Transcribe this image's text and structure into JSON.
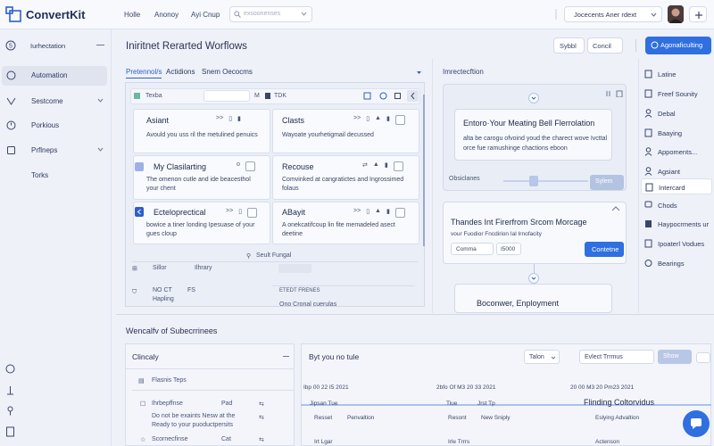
{
  "app": {
    "brand": "ConvertKit"
  },
  "topnav": {
    "items": [
      "Holle",
      "Anonoy",
      "Ayi Cnup"
    ]
  },
  "search": {
    "placeholder": "exsoonenses"
  },
  "account": {
    "name": "Jocecents Aner rdext"
  },
  "sidebar": {
    "section": "Iurhectation",
    "items": [
      {
        "label": "Automation",
        "icon": "lightning-icon",
        "active": true
      },
      {
        "label": "Sestcome",
        "icon": "funnel-icon"
      },
      {
        "label": "Porkious",
        "icon": "clock-icon"
      },
      {
        "label": "Prflneps",
        "icon": "tag-icon"
      },
      {
        "label": "Torks",
        "icon": ""
      }
    ]
  },
  "page": {
    "title": "Iniritnet Rerarted Worflows",
    "sort_label": "Sybbl",
    "cancel_label": "Concil",
    "primary_label": "Agonaficulting"
  },
  "tabs": [
    "Pretennol/s",
    "Actidions",
    "Snem Oecocms"
  ],
  "flow": {
    "toolbar_label": "Texba",
    "toolbar_mid": "TDK",
    "cards": [
      {
        "title": "Asiant",
        "desc": "Avould you uss ril the metulined penuics"
      },
      {
        "title": "Clasts",
        "desc": "Wayoate yourhetigmail decussed"
      },
      {
        "title": "My Clasilarting",
        "desc": "The omenon cutle and ide beacesthol your chent"
      },
      {
        "title": "Recouse",
        "desc": "Comvinked at cangratictes and Ingrossimed folaus"
      },
      {
        "title": "Ecteloprectical",
        "desc": "bowice a tiner londing Ipesuase of your gues cloup"
      },
      {
        "title": "ABayit",
        "desc": "A onekcatifcoup lin fite memadeled asect deetine"
      }
    ],
    "footer_link": "Seult Fungal",
    "rows": [
      {
        "a": "Sillor",
        "b": "Ilhrary"
      },
      {
        "a": "NO CT",
        "b": "FS"
      },
      {
        "a": "Hapling",
        "b": ""
      }
    ],
    "row_right": [
      "ETEDT FRENES",
      "Ono Cronal cuerulas"
    ]
  },
  "workflow": {
    "header": "Imrectecftion",
    "node1": "Entoro·Your Meating Bell Flerrolation",
    "node1_desc": "alta be carogu ofvoind youd the charect wove Ivcttal orce fue ramushinge chactions eboon",
    "slider_label": "Obsiclanes",
    "slider_btn": "Sylem",
    "node2": "Thandes Int Firerfrom Srcom Morcage",
    "node2_desc": "vour Fuodior Fncdirion Ial Irnofacity",
    "node2_select": "Comma",
    "node2_value": "I5000",
    "continue_label": "Contetne",
    "node3": "Boconwer, Enployment"
  },
  "rail": {
    "items": [
      {
        "label": "Latine",
        "icon": "document-icon"
      },
      {
        "label": "Freef Sounity",
        "icon": "document-icon"
      },
      {
        "label": "Debal",
        "icon": "user-icon"
      },
      {
        "label": "Baaying",
        "icon": "file-icon"
      },
      {
        "label": "Appoments...",
        "icon": "person-icon"
      },
      {
        "label": "Agsiant",
        "icon": "person-icon"
      },
      {
        "label": "Intercard",
        "icon": "grid-icon",
        "active": true
      },
      {
        "label": "Chods",
        "icon": "chat-icon"
      },
      {
        "label": "Haypocrments ur",
        "icon": "bookmark-icon"
      },
      {
        "label": "Ipoaterl Vodues",
        "icon": "document-icon"
      },
      {
        "label": "Bearings",
        "icon": "link-icon"
      }
    ]
  },
  "bottom": {
    "title": "Wencalfv of Subecrrinees",
    "col1_title": "Clincaly",
    "col2_title": "Byt you no tule",
    "col2_select": "Talon",
    "col2_filter": "Evlect Trrmus",
    "col2_show": "Show",
    "list_header": "Flasnis Teps",
    "list": [
      {
        "name": "Ihrbepffnse",
        "meta": "Pad",
        "desc": "Do not be exaints Nesw at the Ready to your puoductpersits"
      },
      {
        "name": "Scornecfinse",
        "meta": "Cat",
        "desc": ""
      }
    ],
    "col2_date": "Ibp 00 22 I5 2021",
    "col2_items": [
      "Jipsan Tue",
      "Resset",
      "Penvaltion"
    ],
    "col3_date": "2bfo Of M3 20 33 2021",
    "col3_items": [
      "Tiue",
      "Jrst Tp",
      "Resont",
      "New Sniply"
    ],
    "col4_date": "20 00 M3 20 Pm23 2021",
    "col4_title": "Flinding Coltorvidus",
    "col4_sub": "Eslying Advaltion",
    "col4_bottom": "Actenson",
    "col2_bottom": "Irt Lgar",
    "col3_bottom": "Irle Trrrs"
  }
}
